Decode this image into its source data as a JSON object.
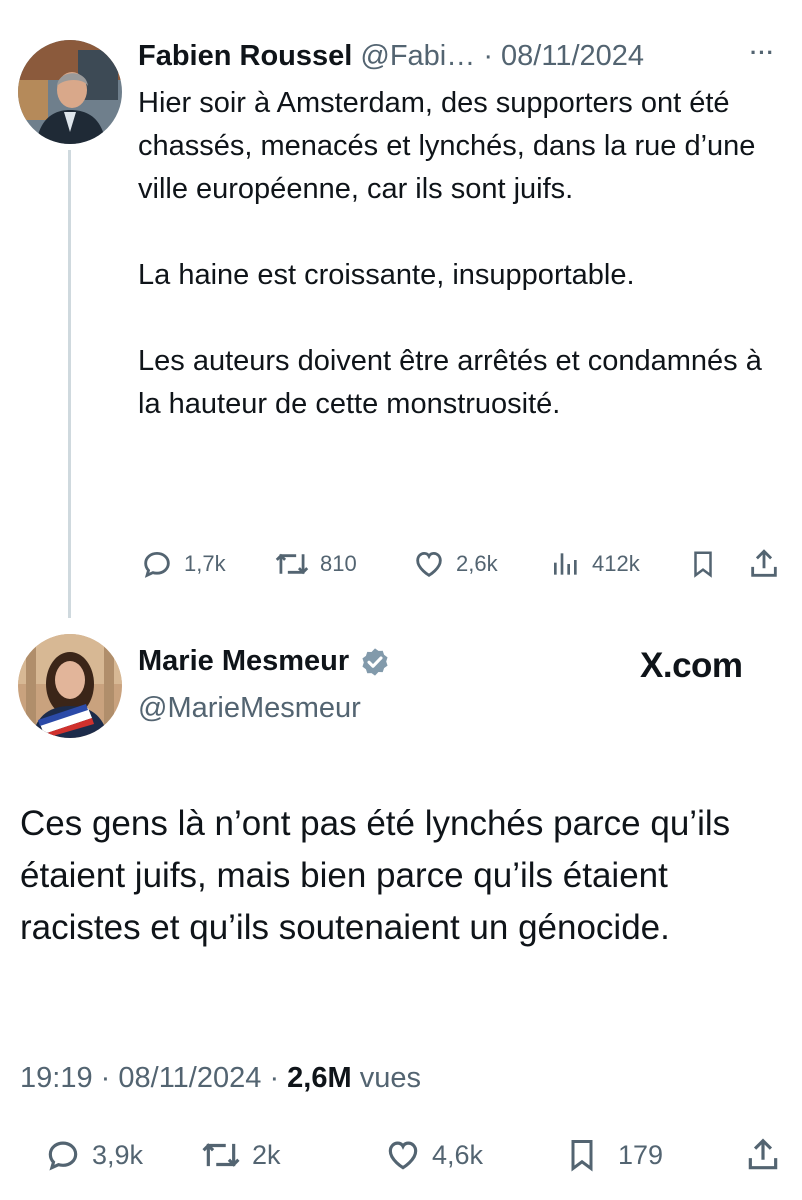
{
  "original_tweet": {
    "author_name": "Fabien Roussel",
    "handle": "@Fabi…",
    "separator": "·",
    "date": "08/11/2024",
    "more_label": "···",
    "paragraphs": [
      "Hier soir à Amsterdam, des supporters ont été chassés, menacés et lynchés, dans la rue d’une ville européenne, car ils sont juifs.",
      "La haine est croissante, insupportable.",
      "Les auteurs doivent être arrêtés et condamnés à la hauteur de cette monstruosité."
    ],
    "stats": {
      "replies": "1,7k",
      "reposts": "810",
      "likes": "2,6k",
      "views": "412k"
    }
  },
  "reply_tweet": {
    "author_name": "Marie Mesmeur",
    "handle": "@MarieMesmeur",
    "verified": true,
    "watermark": "X.com",
    "text": "Ces gens là n’ont pas été lynchés parce qu’ils étaient juifs, mais bien parce qu’ils étaient racistes et qu’ils soutenaient un génocide.",
    "time": "19:19",
    "separator": "·",
    "date": "08/11/2024",
    "views_count": "2,6M",
    "views_label": "vues",
    "stats": {
      "replies": "3,9k",
      "reposts": "2k",
      "likes": "4,6k",
      "bookmarks": "179"
    }
  },
  "colors": {
    "text": "#0f1419",
    "muted": "#536471",
    "thread_line": "#cfd9de",
    "verified": "#829aab"
  }
}
